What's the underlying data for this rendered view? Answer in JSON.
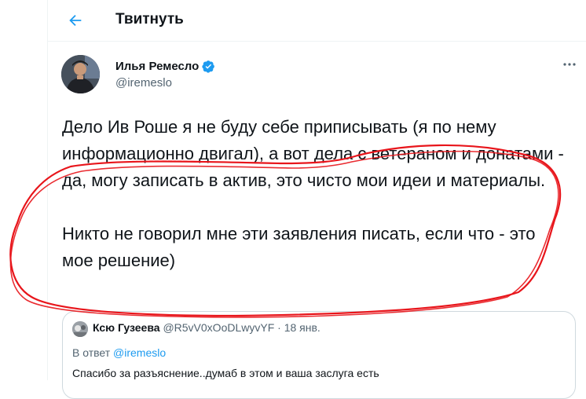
{
  "header": {
    "title": "Твитнуть",
    "back_icon": "arrow-left-icon"
  },
  "tweet": {
    "author_name": "Илья Ремесло",
    "author_handle": "@iremeslo",
    "verified": true,
    "paragraph1": "Дело Ив Роше я не буду себе приписывать (я по нему информационно двигал), а вот дела с ветераном и донатами - да, могу записать в актив, это чисто мои идеи и материалы.",
    "paragraph2": "Никто не говорил мне эти заявления писать, если что - это мое решение)"
  },
  "quote": {
    "name": "Ксю Гузеева",
    "handle": "@R5vV0xOoDLwyvYF",
    "separator": "·",
    "date": "18 янв.",
    "reply_prefix": "В ответ",
    "reply_to": "@iremeslo",
    "text": "Спасибо за разъяснение..думаб в этом и ваша заслуга есть"
  },
  "colors": {
    "accent": "#1d9bf0",
    "annotation": "#e8151b",
    "muted": "#536471"
  }
}
